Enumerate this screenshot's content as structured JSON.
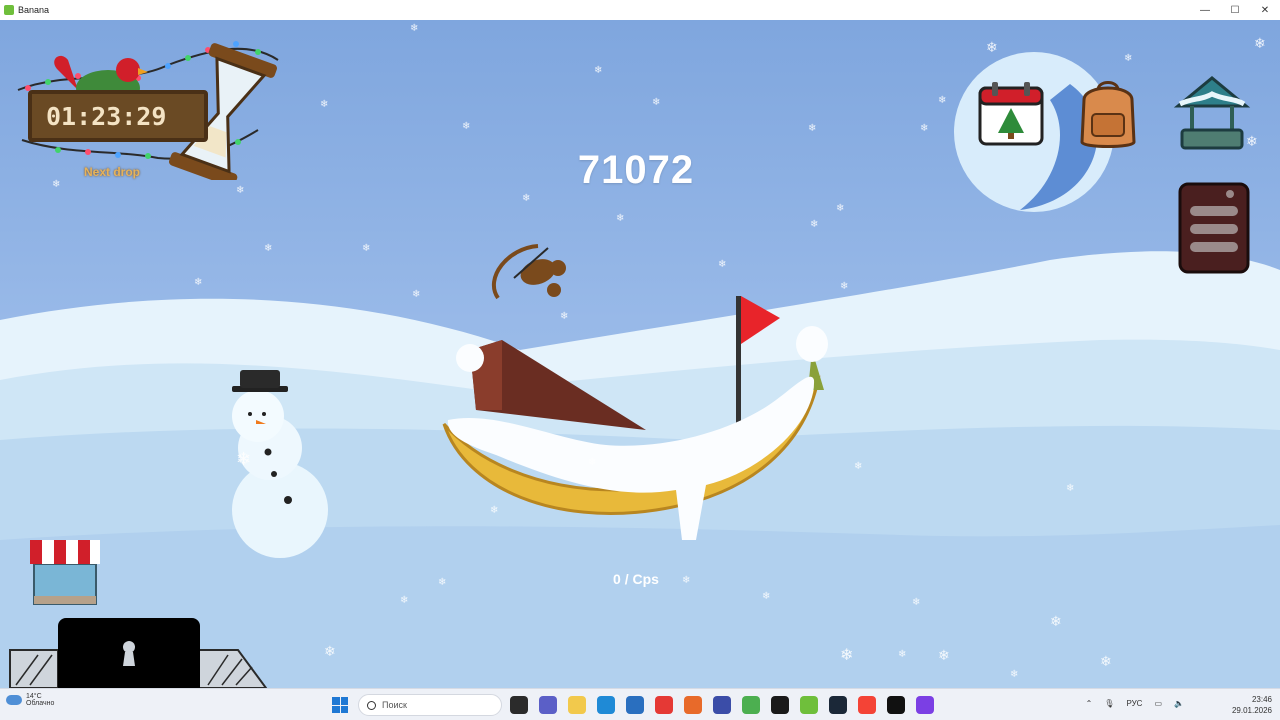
{
  "window": {
    "title": "Banana",
    "minimize": "—",
    "maximize": "☐",
    "close": "✕"
  },
  "game": {
    "timer": "01:23:29",
    "next_drop_label": "Next drop",
    "score": "71072",
    "cps": "0 / Cps"
  },
  "menu_icons": {
    "calendar": "calendar-icon",
    "backpack": "backpack-icon",
    "wishing_well": "wishing-well-icon",
    "menu": "menu-icon",
    "shop": "shop-icon",
    "locked_slot": "lock-icon"
  },
  "taskbar": {
    "weather_temp": "14°C",
    "weather_text": "Облачно",
    "search_placeholder": "Поиск",
    "language": "РУС",
    "time": "23:46",
    "date": "29.01.2026"
  },
  "colors": {
    "sky": "#8fb0e2",
    "snow_hills": "#dceefa",
    "banana": "#e8b93a",
    "flag": "#e8242a",
    "wood": "#6a4a24"
  }
}
